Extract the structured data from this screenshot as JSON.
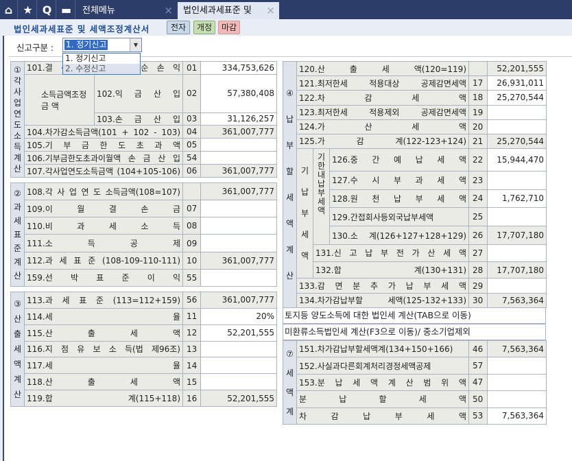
{
  "tabs": {
    "icons": [
      "home-icon",
      "star-icon",
      "quick-search-icon",
      "calendar-icon"
    ],
    "menu_tab": "전체메뉴",
    "active_tab": "법인세과세표준 및",
    "close": "×"
  },
  "header": {
    "title": "법인세과세표준 및 세액조정계산서",
    "buttons": {
      "electronic": "전자",
      "revise": "개정",
      "close_period": "마감"
    }
  },
  "filing": {
    "label": "신고구분 :",
    "selected": "1. 정기신고",
    "options": [
      "1. 정기신고",
      "2. 수정신고"
    ]
  },
  "colors": {
    "tabbar": "#2e3e6a",
    "title": "#1f4c94",
    "btn_blue": "#c9d9ea",
    "btn_green": "#c6dfb0",
    "btn_red": "#f2b9b9"
  },
  "sections": {
    "s1": {
      "side": "①각사업연도소득계산",
      "group": "소득금액조정 금 액",
      "rows": [
        {
          "label": "101.결 산 서 상 당 기 순 손 익",
          "code": "01",
          "value": "334,753,626",
          "calc": false
        },
        {
          "label": "102.익 금 산 입",
          "code": "02",
          "value": "57,380,408",
          "calc": false
        },
        {
          "label": "103.손 금 산 입",
          "code": "03",
          "value": "31,126,257",
          "calc": false
        },
        {
          "label": "104.차가감소득금액(101 + 102 - 103)",
          "code": "04",
          "value": "361,007,777",
          "calc": true
        },
        {
          "label": "105.기 부 금 한 도 초 과 액",
          "code": "05",
          "value": "",
          "calc": false
        },
        {
          "label": "106.기부금한도초과이월액 손 금 산 입",
          "code": "54",
          "value": "",
          "calc": false
        },
        {
          "label": "107.각사업연도소득금액 (104+105-106)",
          "code": "06",
          "value": "361,007,777",
          "calc": true
        }
      ]
    },
    "s2": {
      "side": "②과세표준계산",
      "rows": [
        {
          "label": "108.각 사 업 연 도 소득금액(108=107)",
          "code": "",
          "value": "361,007,777",
          "calc": true
        },
        {
          "label": "109.이 월 결 손 금",
          "code": "07",
          "value": "",
          "calc": false
        },
        {
          "label": "110.비 과 세 소 득",
          "code": "08",
          "value": "",
          "calc": false
        },
        {
          "label": "111.소 득 공 제",
          "code": "09",
          "value": "",
          "calc": false
        },
        {
          "label": "112.과 세 표 준 (108-109-110-111)",
          "code": "10",
          "value": "361,007,777",
          "calc": true
        },
        {
          "label": "159.선 박 표 준 이 익",
          "code": "55",
          "value": "",
          "calc": false
        }
      ]
    },
    "s3": {
      "side": "③산출세액계산",
      "rows": [
        {
          "label": "113.과 세 표 준 (113=112+159)",
          "code": "56",
          "value": "361,007,777",
          "calc": true
        },
        {
          "label": "114.세 율",
          "code": "11",
          "value": "20%",
          "calc": false
        },
        {
          "label": "115.산 출 세 액",
          "code": "12",
          "value": "52,201,555",
          "calc": false
        },
        {
          "label": "116.지 점 유 보 소 득(법 제96조)",
          "code": "13",
          "value": "",
          "calc": false
        },
        {
          "label": "117.세 율",
          "code": "14",
          "value": "",
          "calc": false
        },
        {
          "label": "118.산 출 세 액",
          "code": "15",
          "value": "",
          "calc": false
        },
        {
          "label": "119.합 계(115+118)",
          "code": "16",
          "value": "52,201,555",
          "calc": true
        }
      ]
    },
    "s4": {
      "side": "④납부할세액계산",
      "group1": "기납부세액",
      "group2": "기한내납부세액",
      "rows": [
        {
          "label": "120.산 출 세 액(120=119)",
          "code": "",
          "value": "52,201,555",
          "calc": true
        },
        {
          "label": "121.최저한세 적용대상 공제감면세액",
          "code": "17",
          "value": "26,931,011",
          "calc": false
        },
        {
          "label": "122.차 감 세 액",
          "code": "18",
          "value": "25,270,544",
          "calc": false
        },
        {
          "label": "123.최저한세 적용제외 공제감면세액",
          "code": "19",
          "value": "",
          "calc": false
        },
        {
          "label": "124.가 산 세 액",
          "code": "20",
          "value": "",
          "calc": false
        },
        {
          "label": "125.가 감 계(122-123+124)",
          "code": "21",
          "value": "25,270,544",
          "calc": true
        },
        {
          "label": "126.중 간 예 납 세 액",
          "code": "22",
          "value": "15,944,470",
          "calc": false
        },
        {
          "label": "127.수 시 부 과 세 액",
          "code": "23",
          "value": "",
          "calc": false
        },
        {
          "label": "128.원 천 납 부 세 액",
          "code": "24",
          "value": "1,762,710",
          "calc": false
        },
        {
          "label": "129.간접회사등외국납부세액",
          "code": "25",
          "value": "",
          "calc": false
        },
        {
          "label": "130.소 계(126+127+128+129)",
          "code": "26",
          "value": "17,707,180",
          "calc": true
        },
        {
          "label": "131.신 고 납 부 전 가 산 세 액",
          "code": "27",
          "value": "",
          "calc": false
        },
        {
          "label": "132.합 계(130+131)",
          "code": "28",
          "value": "17,707,180",
          "calc": true
        },
        {
          "label": "133.감 면 분 추 가 납 부 세 액",
          "code": "29",
          "value": "",
          "calc": false
        },
        {
          "label": "134.차가감납부할 세액(125-132+133)",
          "code": "30",
          "value": "7,563,364",
          "calc": true
        }
      ]
    },
    "s7": {
      "side": "⑦세액계",
      "rows": [
        {
          "label": "151.차가감납부할세액계(134+150+166)",
          "code": "46",
          "value": "7,563,364",
          "calc": true
        },
        {
          "label": "152.사실과다른회계처리경정세액공제",
          "code": "57",
          "value": "",
          "calc": false
        },
        {
          "label": "153.분 납 세 액 계 산 범 위 액",
          "code": "47",
          "value": "",
          "calc": false
        },
        {
          "label": "분 납 할 세 액",
          "code": "50",
          "value": "",
          "calc": false
        },
        {
          "label": "차 감 납 부 세 액",
          "code": "53",
          "value": "7,563,364",
          "calc": false
        }
      ]
    }
  },
  "notes": {
    "land": "토지등 양도소득에 대한 법인세 계산(TAB으로 이동)",
    "unreturned": "미환류소득법인세 계산(F3으로 이동)/ 중소기업제외"
  }
}
